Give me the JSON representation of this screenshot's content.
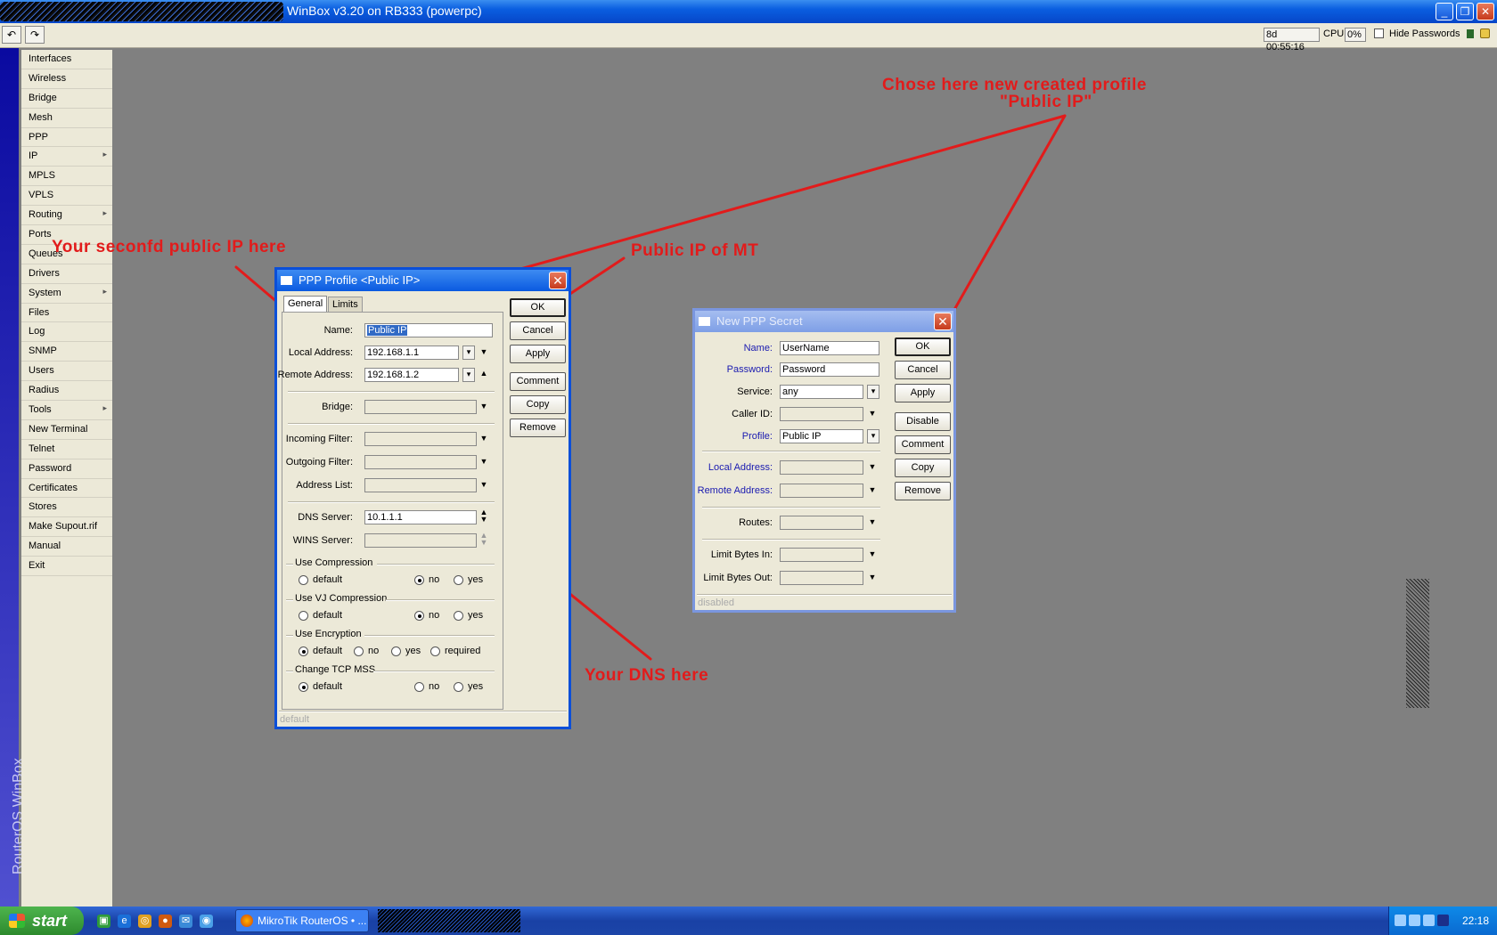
{
  "window": {
    "title": "WinBox v3.20 on RB333 (powerpc)"
  },
  "toolbar": {
    "undo_icon": "↶",
    "redo_icon": "↷",
    "uptime": "8d 00:55:16",
    "cpu_label": "CPU:",
    "cpu_value": "0%",
    "hide_passwords_label": "Hide Passwords"
  },
  "sidebar": {
    "brand": "RouterOS WinBox",
    "items": [
      {
        "label": "Interfaces",
        "submenu": false
      },
      {
        "label": "Wireless",
        "submenu": false
      },
      {
        "label": "Bridge",
        "submenu": false
      },
      {
        "label": "Mesh",
        "submenu": false
      },
      {
        "label": "PPP",
        "submenu": false
      },
      {
        "label": "IP",
        "submenu": true
      },
      {
        "label": "MPLS",
        "submenu": false
      },
      {
        "label": "VPLS",
        "submenu": false
      },
      {
        "label": "Routing",
        "submenu": true
      },
      {
        "label": "Ports",
        "submenu": false
      },
      {
        "label": "Queues",
        "submenu": false
      },
      {
        "label": "Drivers",
        "submenu": false
      },
      {
        "label": "System",
        "submenu": true
      },
      {
        "label": "Files",
        "submenu": false
      },
      {
        "label": "Log",
        "submenu": false
      },
      {
        "label": "SNMP",
        "submenu": false
      },
      {
        "label": "Users",
        "submenu": false
      },
      {
        "label": "Radius",
        "submenu": false
      },
      {
        "label": "Tools",
        "submenu": true
      },
      {
        "label": "New Terminal",
        "submenu": false
      },
      {
        "label": "Telnet",
        "submenu": false
      },
      {
        "label": "Password",
        "submenu": false
      },
      {
        "label": "Certificates",
        "submenu": false
      },
      {
        "label": "Stores",
        "submenu": false
      },
      {
        "label": "Make Supout.rif",
        "submenu": false
      },
      {
        "label": "Manual",
        "submenu": false
      },
      {
        "label": "Exit",
        "submenu": false
      }
    ]
  },
  "ppp_profile": {
    "title": "PPP Profile <Public IP>",
    "tabs": [
      "General",
      "Limits"
    ],
    "name_label": "Name:",
    "name_value": "Public IP",
    "local_address_label": "Local Address:",
    "local_address_value": "192.168.1.1",
    "remote_address_label": "Remote Address:",
    "remote_address_value": "192.168.1.2",
    "bridge_label": "Bridge:",
    "incoming_filter_label": "Incoming Filter:",
    "outgoing_filter_label": "Outgoing Filter:",
    "address_list_label": "Address List:",
    "dns_server_label": "DNS Server:",
    "dns_server_value": "10.1.1.1",
    "wins_server_label": "WINS Server:",
    "use_compression": {
      "label": "Use Compression",
      "options": [
        "default",
        "no",
        "yes"
      ],
      "selected": "no"
    },
    "use_vj_compression": {
      "label": "Use VJ Compression",
      "options": [
        "default",
        "no",
        "yes"
      ],
      "selected": "no"
    },
    "use_encryption": {
      "label": "Use Encryption",
      "options": [
        "default",
        "no",
        "yes",
        "required"
      ],
      "selected": "default"
    },
    "change_tcp_mss": {
      "label": "Change TCP MSS",
      "options": [
        "default",
        "no",
        "yes"
      ],
      "selected": "default"
    },
    "buttons": {
      "ok": "OK",
      "cancel": "Cancel",
      "apply": "Apply",
      "comment": "Comment",
      "copy": "Copy",
      "remove": "Remove"
    },
    "status": "default"
  },
  "ppp_secret": {
    "title": "New PPP Secret",
    "name_label": "Name:",
    "name_value": "UserName",
    "password_label": "Password:",
    "password_value": "Password",
    "service_label": "Service:",
    "service_value": "any",
    "caller_id_label": "Caller ID:",
    "profile_label": "Profile:",
    "profile_value": "Public IP",
    "local_address_label": "Local Address:",
    "remote_address_label": "Remote Address:",
    "routes_label": "Routes:",
    "limit_bytes_in_label": "Limit Bytes In:",
    "limit_bytes_out_label": "Limit Bytes Out:",
    "buttons": {
      "ok": "OK",
      "cancel": "Cancel",
      "apply": "Apply",
      "disable": "Disable",
      "comment": "Comment",
      "copy": "Copy",
      "remove": "Remove"
    },
    "status": "disabled"
  },
  "annotations": {
    "profile_hint_line1": "Chose here new created profile",
    "profile_hint_line2": "\"Public IP\"",
    "public_ip_hint": "Your seconfd public IP here",
    "mt_ip_hint": "Public IP of MT",
    "dns_hint": "Your DNS here",
    "color": "#e21b1b"
  },
  "taskbar": {
    "start_label": "start",
    "task_label": "MikroTik RouterOS • ...",
    "clock": "22:18"
  }
}
